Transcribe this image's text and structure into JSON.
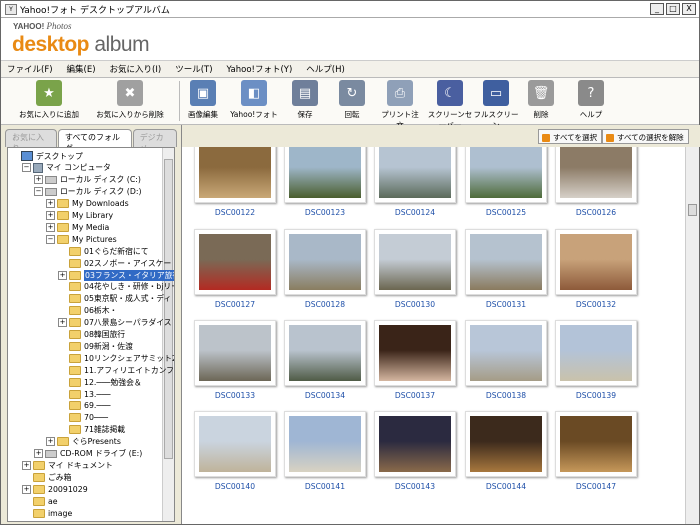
{
  "window": {
    "title": "Yahoo!フォト デスクトップアルバム",
    "min": "_",
    "max": "□",
    "close": "X"
  },
  "logo": {
    "yahoo": "YAHOO!",
    "japan": "JAPAN",
    "photos": "Photos",
    "desktop": "desktop",
    "album": "album"
  },
  "menu": [
    "ファイル(F)",
    "編集(E)",
    "お気に入り(I)",
    "ツール(T)",
    "Yahoo!フォト(Y)",
    "ヘルプ(H)"
  ],
  "toolbar": [
    {
      "label": "お気に入りに追加",
      "icon": "add-favorite-icon"
    },
    {
      "label": "お気に入りから削除",
      "icon": "remove-favorite-icon"
    },
    {
      "label": "画像編集",
      "icon": "image-edit-icon"
    },
    {
      "label": "Yahoo!フォト",
      "icon": "yahoo-photo-icon"
    },
    {
      "label": "保存",
      "icon": "save-icon"
    },
    {
      "label": "回転",
      "icon": "rotate-icon"
    },
    {
      "label": "プリント注文",
      "icon": "print-order-icon"
    },
    {
      "label": "スクリーンセーバー",
      "icon": "screensaver-icon"
    },
    {
      "label": "フルスクリーン",
      "icon": "fullscreen-icon"
    },
    {
      "label": "削除",
      "icon": "trash-icon"
    },
    {
      "label": "ヘルプ",
      "icon": "help-icon"
    }
  ],
  "tabs": [
    "お気に入り",
    "すべてのフォルダ",
    "デジカメ"
  ],
  "tree": [
    {
      "label": "デスクトップ",
      "indent": 0,
      "type": "desktop",
      "pm": ""
    },
    {
      "label": "マイ コンピュータ",
      "indent": 1,
      "type": "pc",
      "pm": "−"
    },
    {
      "label": "ローカル ディスク (C:)",
      "indent": 2,
      "type": "drive",
      "pm": "+"
    },
    {
      "label": "ローカル ディスク (D:)",
      "indent": 2,
      "type": "drive",
      "pm": "−"
    },
    {
      "label": "My Downloads",
      "indent": 3,
      "type": "folder",
      "pm": "+"
    },
    {
      "label": "My Library",
      "indent": 3,
      "type": "folder",
      "pm": "+"
    },
    {
      "label": "My Media",
      "indent": 3,
      "type": "folder",
      "pm": "+"
    },
    {
      "label": "My Pictures",
      "indent": 3,
      "type": "folder",
      "pm": "−"
    },
    {
      "label": "01ぐらだ新宿にて",
      "indent": 4,
      "type": "folder",
      "pm": ""
    },
    {
      "label": "02スノボー・アイスケー",
      "indent": 4,
      "type": "folder",
      "pm": ""
    },
    {
      "label": "03フランス・イタリア旅行",
      "indent": 4,
      "type": "folder",
      "pm": "+",
      "selected": true
    },
    {
      "label": "04花やしき・研修・bjリー",
      "indent": 4,
      "type": "folder",
      "pm": ""
    },
    {
      "label": "05東京駅・成人式・ディ",
      "indent": 4,
      "type": "folder",
      "pm": ""
    },
    {
      "label": "06栃木・",
      "indent": 4,
      "type": "folder",
      "pm": ""
    },
    {
      "label": "07八景島シーパラダイス",
      "indent": 4,
      "type": "folder",
      "pm": "+"
    },
    {
      "label": "08韓国旅行",
      "indent": 4,
      "type": "folder",
      "pm": ""
    },
    {
      "label": "09新潟・佐渡",
      "indent": 4,
      "type": "folder",
      "pm": ""
    },
    {
      "label": "10リンクシェアサミット200",
      "indent": 4,
      "type": "folder",
      "pm": ""
    },
    {
      "label": "11.アフィリエイトカンファレ",
      "indent": 4,
      "type": "folder",
      "pm": ""
    },
    {
      "label": "12.───勉強会＆",
      "indent": 4,
      "type": "folder",
      "pm": ""
    },
    {
      "label": "13.───",
      "indent": 4,
      "type": "folder",
      "pm": ""
    },
    {
      "label": "69.───",
      "indent": 4,
      "type": "folder",
      "pm": ""
    },
    {
      "label": "70───",
      "indent": 4,
      "type": "folder",
      "pm": ""
    },
    {
      "label": "71雑誌掲載",
      "indent": 4,
      "type": "folder",
      "pm": ""
    },
    {
      "label": "ぐらPresents",
      "indent": 3,
      "type": "folder",
      "pm": "+"
    },
    {
      "label": "CD-ROM ドライブ (E:)",
      "indent": 2,
      "type": "drive",
      "pm": "+"
    },
    {
      "label": "マイ ドキュメント",
      "indent": 1,
      "type": "folder",
      "pm": "+"
    },
    {
      "label": "ごみ箱",
      "indent": 1,
      "type": "folder",
      "pm": ""
    },
    {
      "label": "20091029",
      "indent": 1,
      "type": "folder",
      "pm": "+"
    },
    {
      "label": "ae",
      "indent": 1,
      "type": "folder",
      "pm": ""
    },
    {
      "label": "image",
      "indent": 1,
      "type": "folder",
      "pm": ""
    }
  ],
  "actions": {
    "select_all": "すべてを選択",
    "deselect_all": "すべての選択を解除"
  },
  "photos": [
    {
      "name": "DSC00122",
      "colors": [
        "#8b6a3e",
        "#c9a877"
      ]
    },
    {
      "name": "DSC00123",
      "colors": [
        "#9eb6c9",
        "#4a5e2e"
      ]
    },
    {
      "name": "DSC00124",
      "colors": [
        "#b6c4d2",
        "#5b6a5a"
      ]
    },
    {
      "name": "DSC00125",
      "colors": [
        "#aebfd0",
        "#4e6b3a"
      ]
    },
    {
      "name": "DSC00126",
      "colors": [
        "#8c7b66",
        "#d6d0c8"
      ]
    },
    {
      "name": "DSC00127",
      "colors": [
        "#7a6a56",
        "#b32a22"
      ]
    },
    {
      "name": "DSC00128",
      "colors": [
        "#a9b8c8",
        "#8a7d60"
      ]
    },
    {
      "name": "DSC00130",
      "colors": [
        "#c4ccd5",
        "#6b6650"
      ]
    },
    {
      "name": "DSC00131",
      "colors": [
        "#b5c2cf",
        "#8a7a5e"
      ]
    },
    {
      "name": "DSC00132",
      "colors": [
        "#c8a27a",
        "#8d5a3a"
      ]
    },
    {
      "name": "DSC00133",
      "colors": [
        "#bcc3ca",
        "#6c6656"
      ]
    },
    {
      "name": "DSC00134",
      "colors": [
        "#b9c3ce",
        "#4f5b46"
      ]
    },
    {
      "name": "DSC00137",
      "colors": [
        "#3a2418",
        "#d4b6a0"
      ]
    },
    {
      "name": "DSC00138",
      "colors": [
        "#b8c6d8",
        "#a59c86"
      ]
    },
    {
      "name": "DSC00139",
      "colors": [
        "#b3c3d8",
        "#c9c2ab"
      ]
    },
    {
      "name": "DSC00140",
      "colors": [
        "#cad4df",
        "#bfb39a"
      ]
    },
    {
      "name": "DSC00141",
      "colors": [
        "#9fb6d4",
        "#d8d2c2"
      ]
    },
    {
      "name": "DSC00143",
      "colors": [
        "#2b2a40",
        "#8a6a4a"
      ]
    },
    {
      "name": "DSC00144",
      "colors": [
        "#3c2a1c",
        "#a8783e"
      ]
    },
    {
      "name": "DSC00147",
      "colors": [
        "#6a4a24",
        "#c6985a"
      ]
    }
  ]
}
